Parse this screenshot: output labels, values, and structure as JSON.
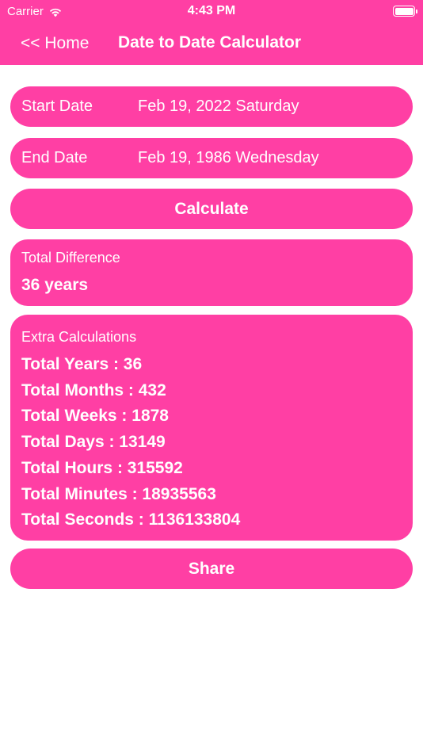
{
  "status_bar": {
    "carrier": "Carrier",
    "time": "4:43 PM"
  },
  "nav": {
    "back_label": "<< Home",
    "title": "Date to Date Calculator"
  },
  "start_date": {
    "label": "Start Date",
    "value": "Feb 19, 2022 Saturday"
  },
  "end_date": {
    "label": "End Date",
    "value": "Feb 19, 1986 Wednesday"
  },
  "calculate_label": "Calculate",
  "total_difference": {
    "label": "Total Difference",
    "value": "36 years"
  },
  "extra": {
    "label": "Extra Calculations",
    "lines": [
      "Total Years : 36",
      "Total Months : 432",
      "Total Weeks : 1878",
      "Total Days : 13149",
      "Total Hours : 315592",
      "Total Minutes : 18935563",
      "Total Seconds : 1136133804"
    ]
  },
  "share_label": "Share",
  "colors": {
    "accent": "#ff3fa4",
    "text": "#ffffff",
    "background": "#ffffff"
  },
  "icons": {
    "signal": "wifi-icon",
    "battery": "battery-icon"
  }
}
